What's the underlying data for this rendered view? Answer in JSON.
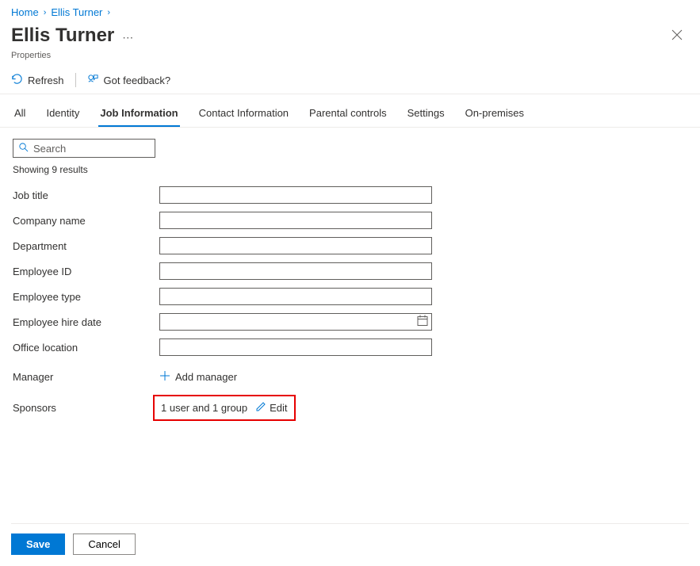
{
  "breadcrumb": {
    "home": "Home",
    "user": "Ellis Turner"
  },
  "header": {
    "title": "Ellis Turner",
    "subtitle": "Properties"
  },
  "toolbar": {
    "refresh": "Refresh",
    "feedback": "Got feedback?"
  },
  "tabs": {
    "all": "All",
    "identity": "Identity",
    "job": "Job Information",
    "contact": "Contact Information",
    "parental": "Parental controls",
    "settings": "Settings",
    "onprem": "On-premises"
  },
  "search": {
    "placeholder": "Search",
    "value": ""
  },
  "results_text": "Showing 9 results",
  "fields": {
    "job_title": {
      "label": "Job title",
      "value": ""
    },
    "company_name": {
      "label": "Company name",
      "value": ""
    },
    "department": {
      "label": "Department",
      "value": ""
    },
    "employee_id": {
      "label": "Employee ID",
      "value": ""
    },
    "employee_type": {
      "label": "Employee type",
      "value": ""
    },
    "hire_date": {
      "label": "Employee hire date",
      "value": ""
    },
    "office_location": {
      "label": "Office location",
      "value": ""
    },
    "manager": {
      "label": "Manager",
      "action": "Add manager"
    },
    "sponsors": {
      "label": "Sponsors",
      "value": "1 user and 1 group",
      "action": "Edit"
    }
  },
  "footer": {
    "save": "Save",
    "cancel": "Cancel"
  }
}
